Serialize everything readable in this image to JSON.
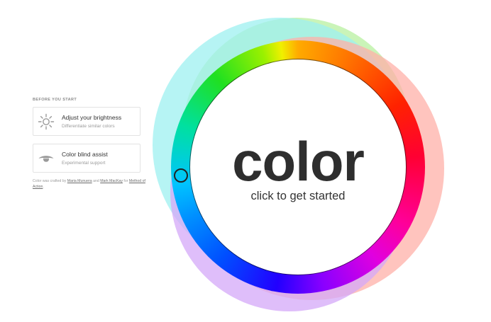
{
  "panel": {
    "section_label": "BEFORE YOU START",
    "cards": [
      {
        "title": "Adjust your brightness",
        "subtitle": "Differentiate similar colors",
        "icon": "sun-icon"
      },
      {
        "title": "Color blind assist",
        "subtitle": "Experimental support",
        "icon": "eye-icon"
      }
    ],
    "credits": {
      "prefix": "Color was crafted by",
      "author1": "Maria Munuera",
      "and": "and",
      "author2": "Mark MacKay",
      "for": "for",
      "org": "Method of Action",
      "period": "."
    }
  },
  "hero": {
    "title": "color",
    "cta": "click to get started"
  },
  "colors": {
    "text": "#333333",
    "muted": "#9a9a9a",
    "outline_green": "#b8f0a0",
    "outline_cyan": "#9ef0f0",
    "outline_red": "#ffb0a8",
    "outline_violet": "#d4a8f8"
  }
}
